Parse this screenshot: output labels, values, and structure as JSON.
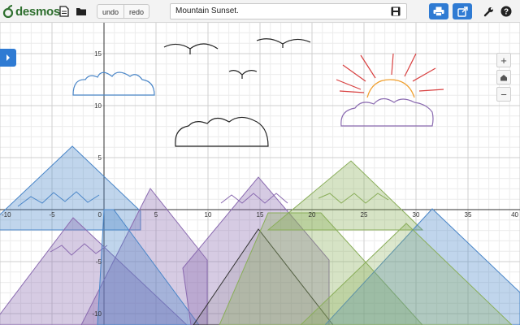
{
  "app": {
    "logo_text": "desmos",
    "graph_title": "Mountain Sunset.",
    "undo_label": "undo",
    "redo_label": "redo"
  },
  "toolbar_icons": {
    "new": "new-document-icon",
    "open": "folder-icon",
    "save": "save-icon",
    "print": "print-icon",
    "share": "share-icon",
    "settings": "wrench-icon",
    "help": "help-icon"
  },
  "zoom": {
    "in_label": "+",
    "home_icon": "home-icon",
    "out_label": "−"
  },
  "axes": {
    "x_ticks": [
      "-10",
      "-5",
      "0",
      "5",
      "10",
      "15",
      "20",
      "25",
      "30",
      "35",
      "40"
    ],
    "y_ticks": [
      "15",
      "10",
      "5",
      "-5",
      "-10"
    ]
  },
  "colors": {
    "brand_green": "#2f6f2f",
    "accent_blue": "#2f7bd3",
    "mountain_blue": "#4a86c8",
    "mountain_purple": "#8a6ab0",
    "mountain_green": "#8aae5a",
    "sun_orange": "#f0a030",
    "ray_red": "#d84040",
    "cloud_blue": "#4a86c8",
    "cloud_purple": "#8a6ab0"
  }
}
